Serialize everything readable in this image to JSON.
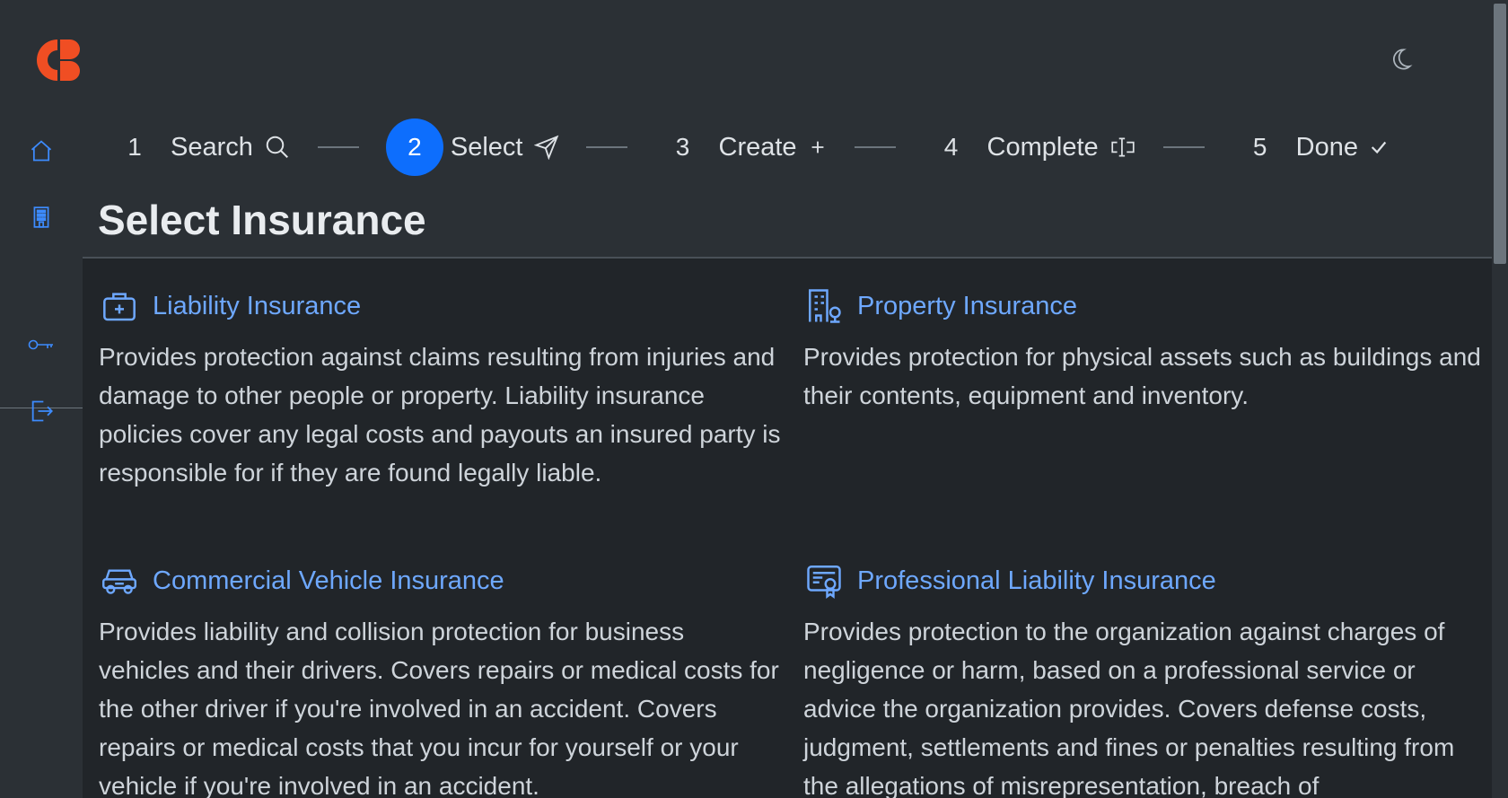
{
  "app": {
    "logo": "brand-logo"
  },
  "header": {
    "theme_toggle_icon": "moon-icon"
  },
  "sidebar": {
    "items": [
      {
        "icon": "house-icon"
      },
      {
        "icon": "building-icon"
      },
      {
        "icon": "key-icon"
      },
      {
        "icon": "logout-icon"
      }
    ]
  },
  "stepper": {
    "steps": [
      {
        "number": "1",
        "label": "Search",
        "icon": "search-icon",
        "active": false
      },
      {
        "number": "2",
        "label": "Select",
        "icon": "send-icon",
        "active": true
      },
      {
        "number": "3",
        "label": "Create",
        "icon": "plus-icon",
        "active": false
      },
      {
        "number": "4",
        "label": "Complete",
        "icon": "input-cursor-icon",
        "active": false
      },
      {
        "number": "5",
        "label": "Done",
        "icon": "check-icon",
        "active": false
      }
    ]
  },
  "page": {
    "title": "Select Insurance"
  },
  "insurance_options": [
    {
      "icon": "briefcase-plus-icon",
      "title": "Liability Insurance",
      "description": "Provides protection against claims resulting from injuries and damage to other people or property. Liability insurance policies cover any legal costs and payouts an insured party is responsible for if they are found legally liable."
    },
    {
      "icon": "building-gear-icon",
      "title": "Property Insurance",
      "description": "Provides protection for physical assets such as buildings and their contents, equipment and inventory."
    },
    {
      "icon": "car-icon",
      "title": "Commercial Vehicle Insurance",
      "description": "Provides liability and collision protection for business vehicles and their drivers. Covers repairs or medical costs for the other driver if you're involved in an accident. Covers repairs or medical costs that you incur for yourself or your vehicle if you're involved in an accident."
    },
    {
      "icon": "certificate-icon",
      "title": "Professional Liability Insurance",
      "description": "Provides protection to the organization against charges of negligence or harm, based on a professional service or advice the organization provides. Covers defense costs, judgment, settlements and fines or penalties resulting from the allegations of misrepresentation, breach of"
    }
  ],
  "colors": {
    "accent": "#0d6efd",
    "link": "#6ea8fe",
    "logo": "#f04e23"
  }
}
